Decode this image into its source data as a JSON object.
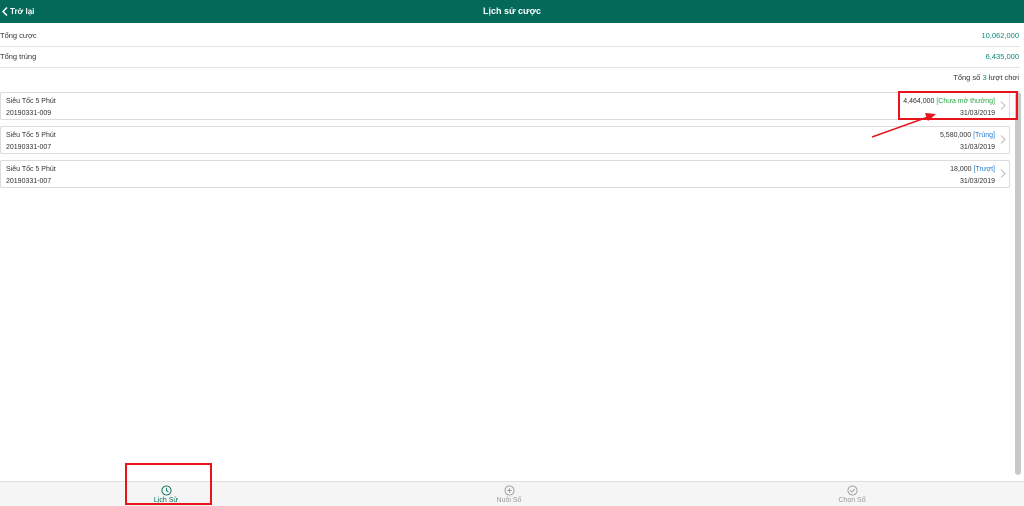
{
  "header": {
    "back_label": "Trở lại",
    "title": "Lịch sử cược"
  },
  "summary": {
    "total_bet_label": "Tổng cược",
    "total_bet_value": "10,062,000",
    "total_win_label": "Tổng trúng",
    "total_win_value": "6,435,000",
    "count_prefix": "Tổng số",
    "count_value": "3",
    "count_suffix": "lượt chơi"
  },
  "bets": [
    {
      "game": "Siêu Tốc 5 Phút",
      "code": "20190331-009",
      "amount": "4,464,000",
      "status": "[Chưa mở thưởng]",
      "date": "31/03/2019"
    },
    {
      "game": "Siêu Tốc 5 Phút",
      "code": "20190331-007",
      "amount": "5,580,000",
      "status": "[Trúng]",
      "date": "31/03/2019"
    },
    {
      "game": "Siêu Tốc 5 Phút",
      "code": "20190331-007",
      "amount": "18,000",
      "status": "[Trượt]",
      "date": "31/03/2019"
    }
  ],
  "tabs": [
    {
      "label": "Lịch Sử",
      "icon": "clock-icon",
      "active": true
    },
    {
      "label": "Nuôi Số",
      "icon": "plus-circle-icon",
      "active": false
    },
    {
      "label": "Chọn Số",
      "icon": "check-circle-icon",
      "active": false
    }
  ],
  "colors": {
    "header_bg": "#05695a",
    "accent": "#0b8a77",
    "pending": "#28a745",
    "result": "#1f7ad1",
    "annotation": "#e8141c"
  }
}
